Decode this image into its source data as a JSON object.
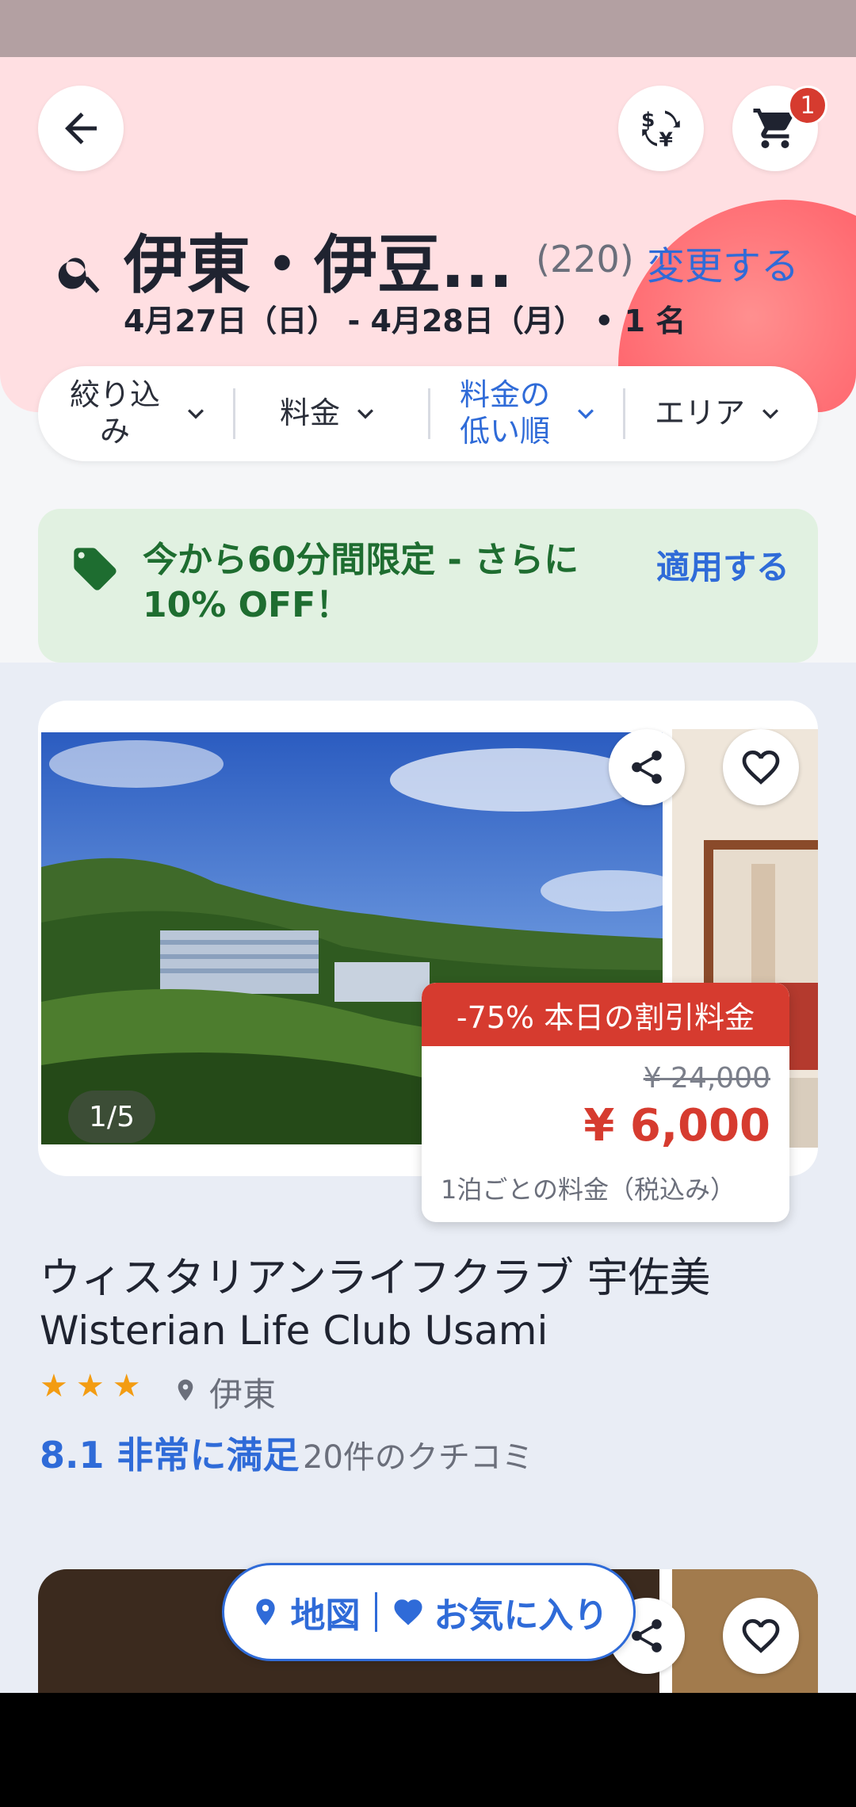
{
  "header": {
    "destination": "伊東・伊豆...",
    "result_count": "(220)",
    "change_label": "変更する",
    "dates_guests": "4月27日（日） - 4月28日（月） • 1 名",
    "cart_count": "1"
  },
  "filters": [
    {
      "label": "絞り込み",
      "active": false
    },
    {
      "label": "料金",
      "active": false
    },
    {
      "label": "料金の低い順",
      "active": true
    },
    {
      "label": "エリア",
      "active": false
    }
  ],
  "promo": {
    "text": "今から60分間限定 - さらに10% OFF！",
    "apply_label": "適用する"
  },
  "listing": {
    "photo_counter": "1/5",
    "discount_tag": "-75% 本日の割引料金",
    "original_price": "¥ 24,000",
    "price": "¥ 6,000",
    "price_note": "1泊ごとの料金（税込み）",
    "name_ja": "ウィスタリアンライフクラブ 宇佐美",
    "name_en": "Wisterian Life Club Usami",
    "star_rating": 3,
    "location": "伊東",
    "rating": "8.1 非常に満足",
    "reviews": "20件のクチコミ"
  },
  "floating_bar": {
    "map_label": "地図",
    "favorites_label": "お気に入り"
  },
  "colors": {
    "accent_blue": "#2f6bd8",
    "discount_red": "#d63b2f",
    "promo_green": "#1e6d30",
    "header_pink": "#ffdfe2"
  }
}
